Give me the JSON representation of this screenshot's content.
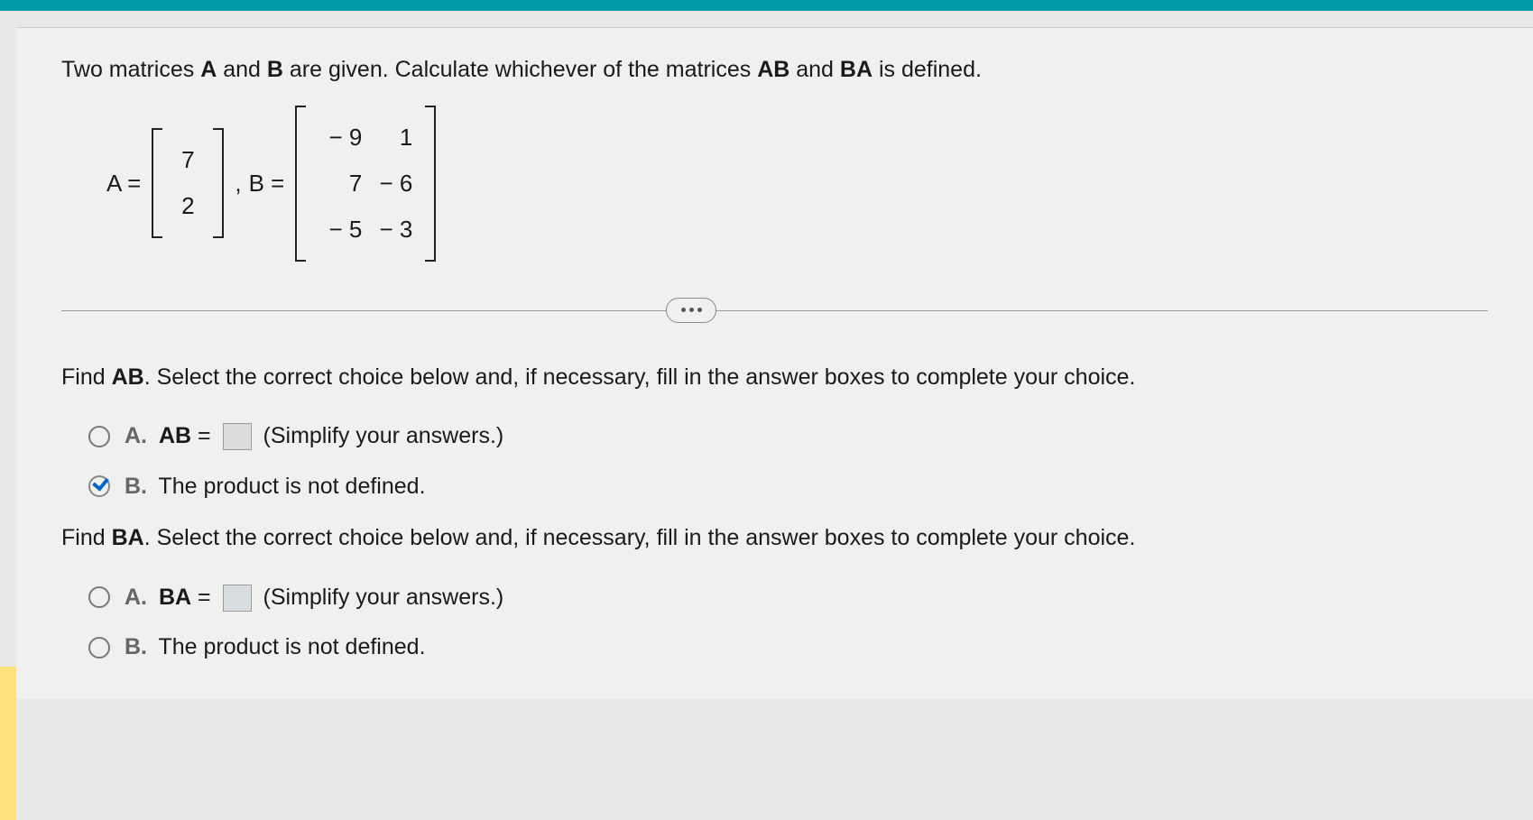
{
  "question": {
    "prefix": "Two matrices ",
    "m1": "A",
    "mid1": " and ",
    "m2": "B",
    "mid2": " are given. Calculate whichever of the matrices ",
    "p1": "AB",
    "mid3": " and ",
    "p2": "BA",
    "suffix": " is defined."
  },
  "matrices": {
    "A_label": "A =",
    "A": [
      [
        "7"
      ],
      [
        "2"
      ]
    ],
    "comma": ",",
    "B_label": "B =",
    "B": [
      [
        "− 9",
        "1"
      ],
      [
        "7",
        "− 6"
      ],
      [
        "− 5",
        "− 3"
      ]
    ]
  },
  "partAB": {
    "prefix": "Find ",
    "prod": "AB",
    "suffix": ". Select the correct choice below and, if necessary, fill in the answer boxes to complete your choice.",
    "choiceA": {
      "letter": "A.",
      "var": "AB",
      "eq": " = ",
      "hint": "(Simplify your answers.)"
    },
    "choiceB": {
      "letter": "B.",
      "text": "The product is not defined."
    }
  },
  "partBA": {
    "prefix": "Find ",
    "prod": "BA",
    "suffix": ". Select the correct choice below and, if necessary, fill in the answer boxes to complete your choice.",
    "choiceA": {
      "letter": "A.",
      "var": "BA",
      "eq": " = ",
      "hint": "(Simplify your answers.)"
    },
    "choiceB": {
      "letter": "B.",
      "text": "The product is not defined."
    }
  }
}
